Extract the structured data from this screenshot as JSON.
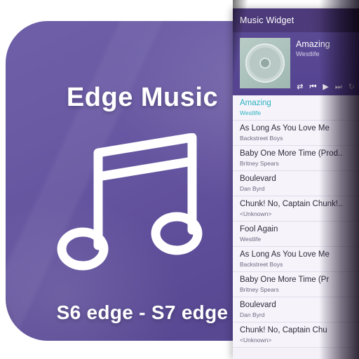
{
  "promo": {
    "title": "Edge Music",
    "subtitle": "S6 edge - S7 edge",
    "icon": "music-note-icon",
    "background_color": "#61509c"
  },
  "widget": {
    "header_title": "Music Widget",
    "accent_color": "#2bb3c0",
    "header_color": "#4d3a7a",
    "now_playing": {
      "album_art": "album-disc-icon",
      "title": "Amazing",
      "artist": "Westlife",
      "controls": [
        {
          "name": "shuffle-icon",
          "glyph": "⇄"
        },
        {
          "name": "previous-icon",
          "glyph": "⏮"
        },
        {
          "name": "play-icon",
          "glyph": "▶"
        },
        {
          "name": "next-icon",
          "glyph": "⏭"
        },
        {
          "name": "repeat-icon",
          "glyph": "↻"
        }
      ]
    },
    "tracks": [
      {
        "title": "Amazing",
        "artist": "Westlife",
        "selected": true
      },
      {
        "title": "As Long As You Love Me",
        "artist": "Backstreet Boys",
        "selected": false
      },
      {
        "title": "Baby One More Time (Prod..",
        "artist": "Britney Spears",
        "selected": false
      },
      {
        "title": "Boulevard",
        "artist": "Dan Byrd",
        "selected": false
      },
      {
        "title": "Chunk! No, Captain Chunk!..",
        "artist": "<Unknown>",
        "selected": false
      },
      {
        "title": "Fool Again",
        "artist": "Westlife",
        "selected": false
      },
      {
        "title": "As Long As You Love Me",
        "artist": "Backstreet Boys",
        "selected": false
      },
      {
        "title": "Baby One More Time (Pr",
        "artist": "Britney Spears",
        "selected": false
      },
      {
        "title": "Boulevard",
        "artist": "Dan Byrd",
        "selected": false
      },
      {
        "title": "Chunk! No, Captain Chu",
        "artist": "<Unknown>",
        "selected": false
      }
    ]
  }
}
